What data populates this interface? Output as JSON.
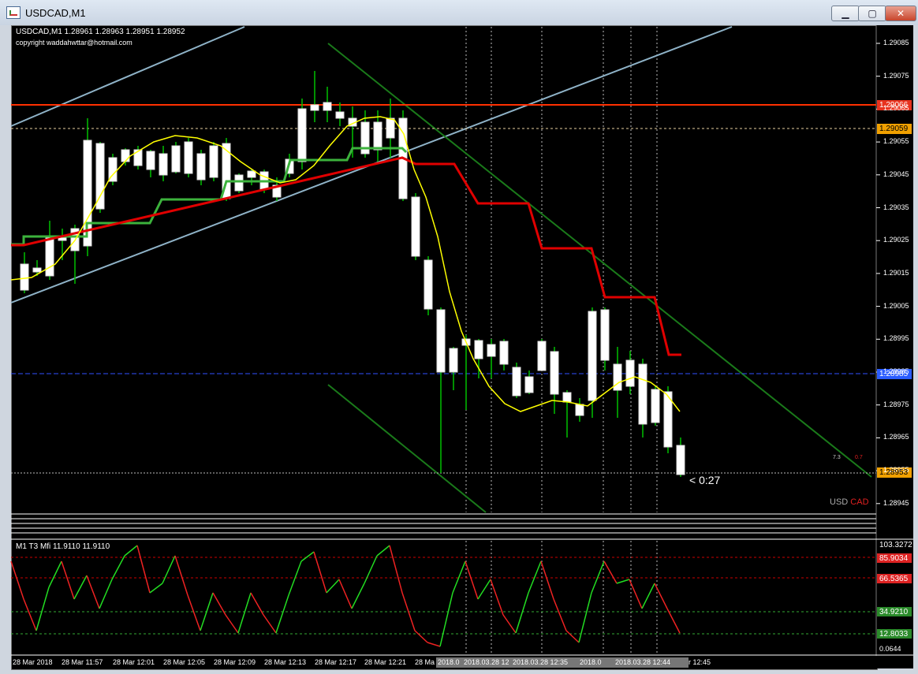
{
  "window": {
    "title": "USDCAD,M1",
    "buttons": {
      "minimize": "▁",
      "maximize": "▢",
      "close": "✕"
    }
  },
  "chart": {
    "header": "USDCAD,M1  1.28961 1.28963 1.28951 1.28952",
    "copyright": "copyright waddahwttar@hotmail.com",
    "countdown": "< 0:27",
    "pair_label": {
      "base": "USD",
      "quote": "CAD"
    },
    "small_values": {
      "left": "7.3",
      "right": "0.7"
    },
    "price_labels": [
      "1.29085",
      "1.29075",
      "1.29065",
      "1.29055",
      "1.29045",
      "1.29035",
      "1.29025",
      "1.29015",
      "1.29005",
      "1.28995",
      "1.28985",
      "1.28975",
      "1.28965",
      "1.28955",
      "1.28945"
    ],
    "marker_labels": {
      "red_line": "1.29066",
      "orange_line": "1.29059",
      "blue_line": "1.28985",
      "bid_line": "1.28953"
    },
    "time_labels": [
      "28 Mar 2018",
      "28 Mar 11:57",
      "28 Mar 12:01",
      "28 Mar 12:05",
      "28 Mar 12:09",
      "28 Mar 12:13",
      "28 Mar 12:17",
      "28 Mar 12:21",
      "28 Ma",
      "2018.0",
      "2018.03.28 12",
      "2018.03.28 12:35",
      "2018.0",
      "2018.03.28 12:44",
      "r 12:45"
    ]
  },
  "indicator": {
    "header": "M1  T3 Mfi  11.9110 11.9110",
    "scale": [
      "103.3272",
      "85.9034",
      "66.5365",
      "34.9210",
      "12.8033",
      "0.0644"
    ],
    "scale_top_clip": "0.00"
  },
  "colors": {
    "background": "#000000",
    "bull": "#ffffff",
    "bear": "#ffffff",
    "wick": "#00c000",
    "yellow_ma": "#ffff00",
    "green_stop": "#3cb23c",
    "red_stop": "#e00000",
    "channel_blue": "#8fb3c8",
    "channel_green": "#1a7a1a",
    "resistance_red": "#ff3000"
  }
}
